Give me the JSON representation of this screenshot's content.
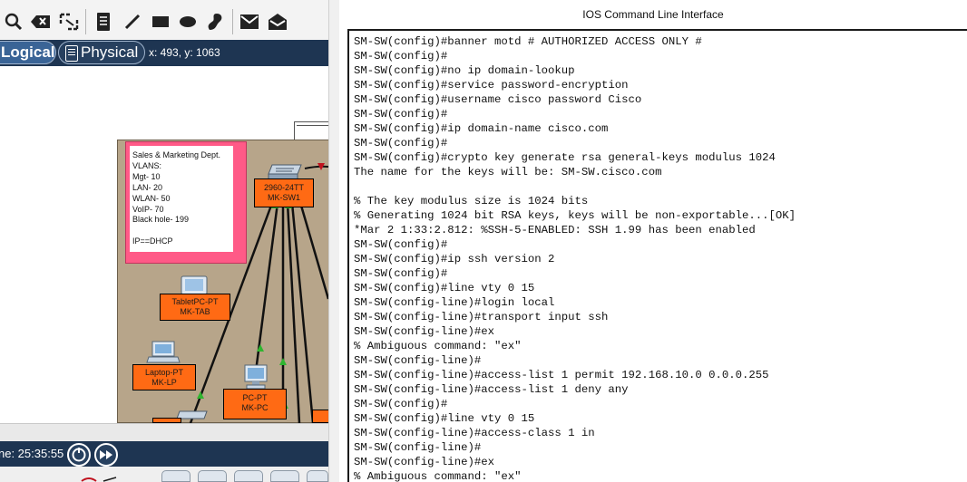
{
  "toolbar": {
    "icons": [
      "search-icon",
      "delete-icon",
      "resize-icon",
      "note-icon",
      "draw-line-icon",
      "rectangle-icon",
      "ellipse-icon",
      "freeform-icon",
      "simple-pdu-icon",
      "complex-pdu-icon"
    ]
  },
  "modebar": {
    "logical_label": "Logical",
    "physical_label": "Physical",
    "coords": "x: 493, y: 1063"
  },
  "workspace": {
    "note_text": "Sales & Marketing Dept.\nVLANS:\nMgt- 10\nLAN- 20\nWLAN- 50\nVoIP- 70\nBlack hole- 199\n\nIP==DHCP",
    "devices": [
      {
        "label": "2960-24TT\nMK-SW1"
      },
      {
        "label": "TabletPC-PT\nMK-TAB"
      },
      {
        "label": "Laptop-PT\nMK-LP"
      },
      {
        "label": "PC-PT\nMK-PC"
      }
    ],
    "colors": {
      "area": "#b7a58a",
      "note_border": "#ff5a87",
      "device_label": "#ff6a14",
      "link_up": "#2fb52f"
    }
  },
  "timebar": {
    "time_text": "ne: 25:35:55"
  },
  "cli": {
    "title": "IOS Command Line Interface",
    "lines": [
      "SM-SW(config)#banner motd # AUTHORIZED ACCESS ONLY #",
      "SM-SW(config)#",
      "SM-SW(config)#no ip domain-lookup",
      "SM-SW(config)#service password-encryption",
      "SM-SW(config)#username cisco password Cisco",
      "SM-SW(config)#",
      "SM-SW(config)#ip domain-name cisco.com",
      "SM-SW(config)#",
      "SM-SW(config)#crypto key generate rsa general-keys modulus 1024",
      "The name for the keys will be: SM-SW.cisco.com",
      "",
      "% The key modulus size is 1024 bits",
      "% Generating 1024 bit RSA keys, keys will be non-exportable...[OK]",
      "*Mar 2 1:33:2.812: %SSH-5-ENABLED: SSH 1.99 has been enabled",
      "SM-SW(config)#",
      "SM-SW(config)#ip ssh version 2",
      "SM-SW(config)#",
      "SM-SW(config)#line vty 0 15",
      "SM-SW(config-line)#login local",
      "SM-SW(config-line)#transport input ssh",
      "SM-SW(config-line)#ex",
      "% Ambiguous command: \"ex\"",
      "SM-SW(config-line)#",
      "SM-SW(config-line)#access-list 1 permit 192.168.10.0 0.0.0.255",
      "SM-SW(config-line)#access-list 1 deny any",
      "SM-SW(config)#",
      "SM-SW(config)#line vty 0 15",
      "SM-SW(config-line)#access-class 1 in",
      "SM-SW(config-line)#",
      "SM-SW(config-line)#ex",
      "% Ambiguous command: \"ex\""
    ]
  }
}
